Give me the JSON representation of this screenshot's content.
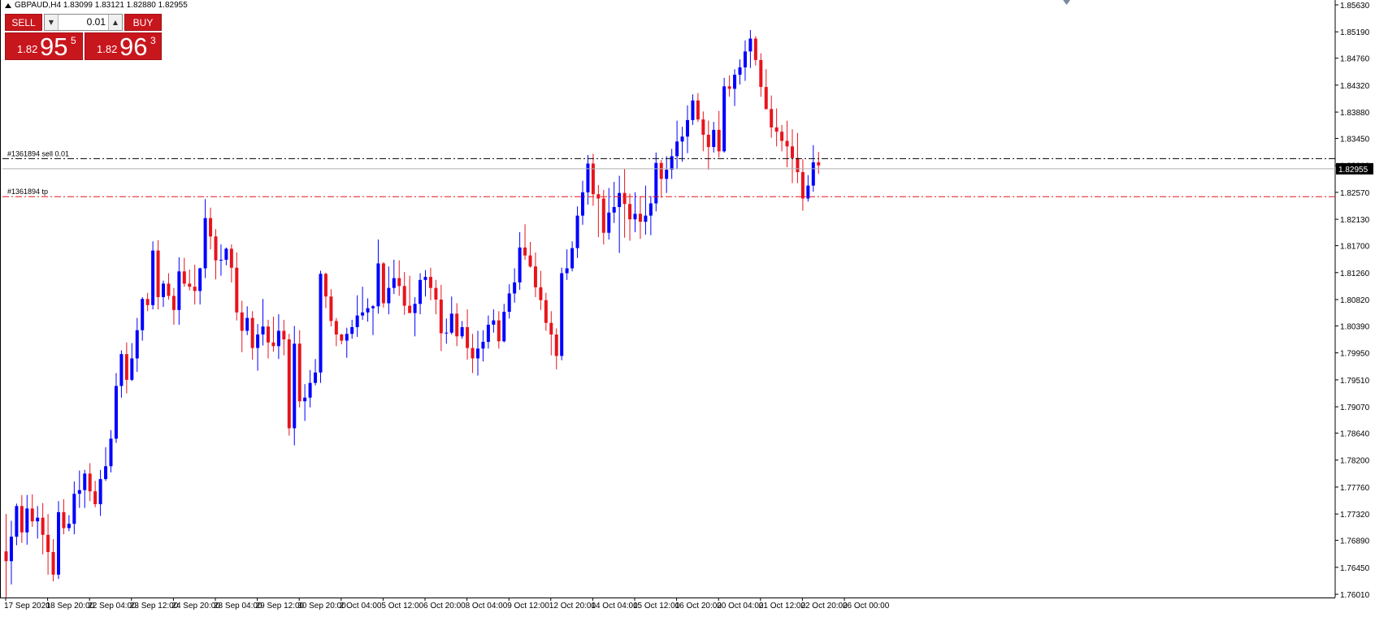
{
  "chart": {
    "symbol_info": "GBPAUD,H4  1.83099 1.83121 1.82880 1.82955",
    "current_price": "1.82955",
    "order_label": "#1361894 sell 0.01",
    "tp_label": "#1361894 tp",
    "order_price": 1.8312,
    "tp_price": 1.825,
    "price_axis": {
      "min": 1.7601,
      "max": 1.8563,
      "ticks": [
        "1.85630",
        "1.85190",
        "1.84760",
        "1.84320",
        "1.83880",
        "1.83450",
        "1.83010",
        "1.82570",
        "1.82130",
        "1.81700",
        "1.81260",
        "1.80820",
        "1.80390",
        "1.79950",
        "1.79510",
        "1.79070",
        "1.78640",
        "1.78200",
        "1.77760",
        "1.77320",
        "1.76890",
        "1.76450",
        "1.76010"
      ]
    },
    "time_axis": [
      "17 Sep 2020",
      "18 Sep 20:00",
      "22 Sep 04:00",
      "23 Sep 12:00",
      "24 Sep 20:00",
      "28 Sep 04:00",
      "29 Sep 12:00",
      "30 Sep 20:00",
      "2 Oct 04:00",
      "5 Oct 12:00",
      "6 Oct 20:00",
      "8 Oct 04:00",
      "9 Oct 12:00",
      "12 Oct 20:00",
      "14 Oct 04:00",
      "15 Oct 12:00",
      "16 Oct 20:00",
      "20 Oct 04:00",
      "21 Oct 12:00",
      "22 Oct 20:00",
      "26 Oct 00:00"
    ],
    "colors": {
      "bull": "#0000ff",
      "bear": "#e8141c",
      "order_line": "#000000",
      "tp_line": "#e8141c",
      "background": "#ffffff"
    },
    "closes": [
      1.7655,
      1.7695,
      1.7745,
      1.7702,
      1.7741,
      1.772,
      1.7726,
      1.7698,
      1.767,
      1.7633,
      1.7735,
      1.7709,
      1.7716,
      1.7765,
      1.7771,
      1.7798,
      1.7769,
      1.7748,
      1.7789,
      1.781,
      1.7855,
      1.7941,
      1.7993,
      1.7951,
      1.7986,
      1.8032,
      1.8083,
      1.8073,
      1.8162,
      1.8086,
      1.8108,
      1.8088,
      1.8065,
      1.8128,
      1.8108,
      1.8103,
      1.8096,
      1.8133,
      1.8215,
      1.8185,
      1.8146,
      1.8147,
      1.8165,
      1.8134,
      1.8061,
      1.8031,
      1.8052,
      1.8003,
      1.8025,
      1.8038,
      1.8012,
      1.8006,
      1.8031,
      1.8017,
      1.7872,
      1.801,
      1.7916,
      1.7922,
      1.7946,
      1.7963,
      1.8124,
      1.8087,
      1.8047,
      1.8025,
      1.8015,
      1.8026,
      1.8037,
      1.8056,
      1.8061,
      1.8068,
      1.8071,
      1.8141,
      1.8076,
      1.8101,
      1.8117,
      1.8104,
      1.8072,
      1.806,
      1.8075,
      1.8114,
      1.8119,
      1.8101,
      1.8082,
      1.8027,
      1.8028,
      1.8059,
      1.8022,
      1.8037,
      1.8003,
      1.7986,
      1.8002,
      1.8013,
      1.8041,
      1.8048,
      1.8014,
      1.8062,
      1.8092,
      1.811,
      1.8167,
      1.8154,
      1.8136,
      1.8102,
      1.8081,
      1.8044,
      1.8025,
      1.799,
      1.8125,
      1.8133,
      1.8166,
      1.8219,
      1.8257,
      1.8304,
      1.8254,
      1.8247,
      1.8191,
      1.8224,
      1.8233,
      1.8256,
      1.8238,
      1.8213,
      1.8222,
      1.8209,
      1.8219,
      1.8239,
      1.8305,
      1.8279,
      1.8294,
      1.8316,
      1.834,
      1.8348,
      1.8375,
      1.8407,
      1.8376,
      1.8351,
      1.8331,
      1.8359,
      1.8324,
      1.843,
      1.8426,
      1.8449,
      1.8461,
      1.8487,
      1.8508,
      1.8473,
      1.8429,
      1.8393,
      1.8363,
      1.8356,
      1.8341,
      1.8332,
      1.8313,
      1.829,
      1.8247,
      1.8268,
      1.8306,
      1.8301
    ],
    "candles": [
      [
        1.7671,
        1.7732,
        1.7596,
        1.7655
      ],
      [
        1.7655,
        1.7721,
        1.7617,
        1.7695
      ],
      [
        1.7695,
        1.7749,
        1.7681,
        1.7745
      ],
      [
        1.7745,
        1.7763,
        1.7685,
        1.7702
      ],
      [
        1.7702,
        1.7763,
        1.7682,
        1.7741
      ],
      [
        1.7741,
        1.7764,
        1.7711,
        1.772
      ],
      [
        1.772,
        1.7745,
        1.7692,
        1.7726
      ],
      [
        1.7726,
        1.775,
        1.7666,
        1.7698
      ],
      [
        1.7698,
        1.7732,
        1.7633,
        1.767
      ],
      [
        1.767,
        1.7691,
        1.7622,
        1.7633
      ],
      [
        1.7633,
        1.7753,
        1.7626,
        1.7735
      ],
      [
        1.7735,
        1.7756,
        1.7699,
        1.7709
      ],
      [
        1.7709,
        1.773,
        1.7704,
        1.7716
      ],
      [
        1.7716,
        1.7785,
        1.7699,
        1.7765
      ],
      [
        1.7765,
        1.7803,
        1.7742,
        1.7771
      ],
      [
        1.7771,
        1.7804,
        1.7742,
        1.7798
      ],
      [
        1.7798,
        1.7815,
        1.7753,
        1.7769
      ],
      [
        1.7769,
        1.7786,
        1.7743,
        1.7748
      ],
      [
        1.7748,
        1.7804,
        1.7729,
        1.7789
      ],
      [
        1.7789,
        1.7841,
        1.7786,
        1.781
      ],
      [
        1.781,
        1.7869,
        1.78,
        1.7855
      ],
      [
        1.7855,
        1.7962,
        1.7848,
        1.7941
      ],
      [
        1.7941,
        1.7999,
        1.7922,
        1.7993
      ],
      [
        1.7993,
        1.8012,
        1.7929,
        1.7951
      ],
      [
        1.7951,
        1.8011,
        1.7949,
        1.7986
      ],
      [
        1.7986,
        1.8052,
        1.7964,
        1.8032
      ],
      [
        1.8032,
        1.8086,
        1.8015,
        1.8083
      ],
      [
        1.8083,
        1.8093,
        1.8063,
        1.8073
      ],
      [
        1.8073,
        1.8177,
        1.8066,
        1.8162
      ],
      [
        1.8162,
        1.8179,
        1.8066,
        1.8086
      ],
      [
        1.8086,
        1.8113,
        1.807,
        1.8108
      ],
      [
        1.8108,
        1.8125,
        1.8082,
        1.8088
      ],
      [
        1.8088,
        1.8101,
        1.8041,
        1.8065
      ],
      [
        1.8065,
        1.8151,
        1.8041,
        1.8128
      ],
      [
        1.8128,
        1.815,
        1.8103,
        1.8108
      ],
      [
        1.8108,
        1.8131,
        1.8097,
        1.8103
      ],
      [
        1.8103,
        1.8139,
        1.8074,
        1.8096
      ],
      [
        1.8096,
        1.8134,
        1.8074,
        1.8133
      ],
      [
        1.8133,
        1.8246,
        1.8117,
        1.8215
      ],
      [
        1.8215,
        1.8232,
        1.8164,
        1.8185
      ],
      [
        1.8185,
        1.8197,
        1.8115,
        1.8146
      ],
      [
        1.8146,
        1.8172,
        1.8121,
        1.8147
      ],
      [
        1.8147,
        1.8167,
        1.8138,
        1.8165
      ],
      [
        1.8165,
        1.8172,
        1.811,
        1.8134
      ],
      [
        1.8134,
        1.8159,
        1.8048,
        1.8061
      ],
      [
        1.8061,
        1.808,
        1.7996,
        1.8031
      ],
      [
        1.8031,
        1.8071,
        1.8024,
        1.8052
      ],
      [
        1.8052,
        1.8063,
        1.7984,
        1.8003
      ],
      [
        1.8003,
        1.8042,
        1.7966,
        1.8025
      ],
      [
        1.8025,
        1.8083,
        1.8007,
        1.8038
      ],
      [
        1.8038,
        1.8049,
        1.7986,
        1.8012
      ],
      [
        1.8012,
        1.8054,
        1.7997,
        1.8006
      ],
      [
        1.8006,
        1.8058,
        1.7985,
        1.8031
      ],
      [
        1.8031,
        1.8049,
        1.7991,
        1.8017
      ],
      [
        1.8017,
        1.8026,
        1.786,
        1.7872
      ],
      [
        1.7872,
        1.8039,
        1.7844,
        1.801
      ],
      [
        1.801,
        1.8032,
        1.7906,
        1.7916
      ],
      [
        1.7916,
        1.7944,
        1.7884,
        1.7922
      ],
      [
        1.7922,
        1.7967,
        1.7906,
        1.7946
      ],
      [
        1.7946,
        1.7985,
        1.7942,
        1.7963
      ],
      [
        1.7963,
        1.8129,
        1.7946,
        1.8124
      ],
      [
        1.8124,
        1.8126,
        1.8068,
        1.8087
      ],
      [
        1.8087,
        1.8099,
        1.8038,
        1.8047
      ],
      [
        1.8047,
        1.8052,
        1.8006,
        1.8025
      ],
      [
        1.8025,
        1.8026,
        1.8009,
        1.8015
      ],
      [
        1.8015,
        1.8036,
        1.7987,
        1.8026
      ],
      [
        1.8026,
        1.8049,
        1.8018,
        1.8037
      ],
      [
        1.8037,
        1.8089,
        1.8021,
        1.8056
      ],
      [
        1.8056,
        1.8103,
        1.8049,
        1.8061
      ],
      [
        1.8061,
        1.8084,
        1.8046,
        1.8068
      ],
      [
        1.8068,
        1.8073,
        1.8024,
        1.8071
      ],
      [
        1.8071,
        1.818,
        1.8059,
        1.8141
      ],
      [
        1.8141,
        1.8143,
        1.8069,
        1.8076
      ],
      [
        1.8076,
        1.8136,
        1.8058,
        1.8101
      ],
      [
        1.8101,
        1.8147,
        1.8091,
        1.8117
      ],
      [
        1.8117,
        1.8146,
        1.8088,
        1.8104
      ],
      [
        1.8104,
        1.8127,
        1.8057,
        1.8072
      ],
      [
        1.8072,
        1.8121,
        1.806,
        1.806
      ],
      [
        1.806,
        1.8086,
        1.8022,
        1.8075
      ],
      [
        1.8075,
        1.8125,
        1.8058,
        1.8114
      ],
      [
        1.8114,
        1.813,
        1.8087,
        1.8119
      ],
      [
        1.8119,
        1.8134,
        1.8081,
        1.8101
      ],
      [
        1.8101,
        1.8114,
        1.8058,
        1.8082
      ],
      [
        1.8082,
        1.8106,
        1.7998,
        1.8027
      ],
      [
        1.8027,
        1.8051,
        1.801,
        1.8028
      ],
      [
        1.8028,
        1.8087,
        1.8025,
        1.8059
      ],
      [
        1.8059,
        1.8076,
        1.8006,
        1.8022
      ],
      [
        1.8022,
        1.8047,
        1.8018,
        1.8037
      ],
      [
        1.8037,
        1.8066,
        1.7984,
        1.8003
      ],
      [
        1.8003,
        1.8026,
        1.7962,
        1.7986
      ],
      [
        1.7986,
        1.8031,
        1.7958,
        1.8002
      ],
      [
        1.8002,
        1.8032,
        1.7981,
        1.8013
      ],
      [
        1.8013,
        1.8056,
        1.8002,
        1.8041
      ],
      [
        1.8041,
        1.8066,
        1.8028,
        1.8048
      ],
      [
        1.8048,
        1.8063,
        1.8002,
        1.8014
      ],
      [
        1.8014,
        1.8075,
        1.8012,
        1.8062
      ],
      [
        1.8062,
        1.8107,
        1.8051,
        1.8092
      ],
      [
        1.8092,
        1.8133,
        1.8077,
        1.811
      ],
      [
        1.811,
        1.8192,
        1.8098,
        1.8167
      ],
      [
        1.8167,
        1.8205,
        1.8147,
        1.8154
      ],
      [
        1.8154,
        1.8176,
        1.8134,
        1.8136
      ],
      [
        1.8136,
        1.8159,
        1.8086,
        1.8102
      ],
      [
        1.8102,
        1.8129,
        1.8065,
        1.8081
      ],
      [
        1.8081,
        1.8093,
        1.8031,
        1.8044
      ],
      [
        1.8044,
        1.8063,
        1.7991,
        1.8025
      ],
      [
        1.8025,
        1.8035,
        1.7968,
        1.799
      ],
      [
        1.799,
        1.8134,
        1.7983,
        1.8125
      ],
      [
        1.8125,
        1.8164,
        1.8114,
        1.8133
      ],
      [
        1.8133,
        1.8177,
        1.8128,
        1.8166
      ],
      [
        1.8166,
        1.8234,
        1.815,
        1.8219
      ],
      [
        1.8219,
        1.8276,
        1.8204,
        1.8257
      ],
      [
        1.8257,
        1.8318,
        1.8237,
        1.8304
      ],
      [
        1.8304,
        1.832,
        1.8235,
        1.8254
      ],
      [
        1.8254,
        1.8269,
        1.8184,
        1.8247
      ],
      [
        1.8247,
        1.8261,
        1.8172,
        1.8191
      ],
      [
        1.8191,
        1.8264,
        1.818,
        1.8224
      ],
      [
        1.8224,
        1.8274,
        1.8207,
        1.8233
      ],
      [
        1.8233,
        1.8284,
        1.8158,
        1.8256
      ],
      [
        1.8256,
        1.8295,
        1.8183,
        1.8238
      ],
      [
        1.8238,
        1.8255,
        1.8178,
        1.8213
      ],
      [
        1.8213,
        1.8257,
        1.8192,
        1.8222
      ],
      [
        1.8222,
        1.825,
        1.8181,
        1.8209
      ],
      [
        1.8209,
        1.8268,
        1.8188,
        1.8219
      ],
      [
        1.8219,
        1.8251,
        1.8187,
        1.8239
      ],
      [
        1.8239,
        1.8322,
        1.8226,
        1.8305
      ],
      [
        1.8305,
        1.831,
        1.8248,
        1.8279
      ],
      [
        1.8279,
        1.8316,
        1.8256,
        1.8294
      ],
      [
        1.8294,
        1.8328,
        1.8279,
        1.8316
      ],
      [
        1.8316,
        1.8374,
        1.8295,
        1.834
      ],
      [
        1.834,
        1.8364,
        1.8307,
        1.8348
      ],
      [
        1.8348,
        1.8399,
        1.8321,
        1.8375
      ],
      [
        1.8375,
        1.8417,
        1.8367,
        1.8407
      ],
      [
        1.8407,
        1.8419,
        1.8372,
        1.8376
      ],
      [
        1.8376,
        1.8389,
        1.8324,
        1.8351
      ],
      [
        1.8351,
        1.8374,
        1.8294,
        1.8331
      ],
      [
        1.8331,
        1.8372,
        1.8322,
        1.8359
      ],
      [
        1.8359,
        1.839,
        1.8314,
        1.8324
      ],
      [
        1.8324,
        1.8444,
        1.8322,
        1.843
      ],
      [
        1.843,
        1.8448,
        1.8413,
        1.8426
      ],
      [
        1.8426,
        1.8458,
        1.8398,
        1.8449
      ],
      [
        1.8449,
        1.8474,
        1.8433,
        1.8461
      ],
      [
        1.8461,
        1.8505,
        1.8439,
        1.8487
      ],
      [
        1.8487,
        1.8522,
        1.846,
        1.8508
      ],
      [
        1.8508,
        1.8512,
        1.8464,
        1.8473
      ],
      [
        1.8473,
        1.8484,
        1.8413,
        1.8429
      ],
      [
        1.8429,
        1.8458,
        1.8392,
        1.8393
      ],
      [
        1.8393,
        1.8415,
        1.8346,
        1.8363
      ],
      [
        1.8363,
        1.8394,
        1.8332,
        1.8356
      ],
      [
        1.8356,
        1.8367,
        1.8324,
        1.8341
      ],
      [
        1.8341,
        1.8374,
        1.8298,
        1.8332
      ],
      [
        1.8332,
        1.836,
        1.8272,
        1.8313
      ],
      [
        1.8313,
        1.8354,
        1.8272,
        1.829
      ],
      [
        1.829,
        1.8311,
        1.8227,
        1.8247
      ],
      [
        1.8247,
        1.8285,
        1.8242,
        1.8268
      ],
      [
        1.8268,
        1.8334,
        1.8258,
        1.8306
      ],
      [
        1.8306,
        1.8323,
        1.8287,
        1.8301
      ]
    ]
  },
  "panel": {
    "sell_label": "SELL",
    "buy_label": "BUY",
    "lot": "0.01",
    "sell_price": {
      "prefix": "1.82",
      "big": "95",
      "sup": "5"
    },
    "buy_price": {
      "prefix": "1.82",
      "big": "96",
      "sup": "3"
    }
  }
}
